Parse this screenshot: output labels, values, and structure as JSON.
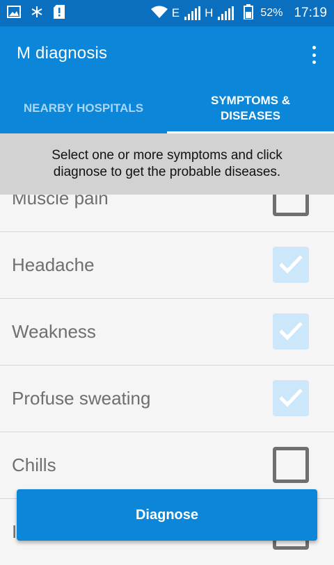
{
  "status_bar": {
    "left_icons": [
      "image-icon",
      "snowflake-icon",
      "sim-alert-icon"
    ],
    "signal_1_label": "E",
    "signal_2_label": "H",
    "battery_percent": "52%",
    "time": "17:19"
  },
  "app_bar": {
    "title": "M diagnosis",
    "overflow_icon": "more-vert-icon"
  },
  "tabs": [
    {
      "label": "NEARBY HOSPITALS",
      "active": false
    },
    {
      "label": "SYMPTOMS &\nDISEASES",
      "active": true
    }
  ],
  "banner": {
    "text": "Select one or more symptoms and click diagnose to get the probable diseases."
  },
  "symptoms": [
    {
      "label": "Muscle pain",
      "checked": false
    },
    {
      "label": "Headache",
      "checked": true
    },
    {
      "label": "Weakness",
      "checked": true
    },
    {
      "label": "Profuse sweating",
      "checked": true
    },
    {
      "label": "Chills",
      "checked": false
    },
    {
      "label": "I",
      "checked": false
    }
  ],
  "diagnose_button": {
    "label": "Diagnose"
  },
  "colors": {
    "status_bar": "#0a6fbf",
    "primary": "#0b86d9",
    "tab_inactive_text": "#a9d6f7",
    "banner_bg": "#d2d2d2",
    "checked_box": "#cce6fa"
  }
}
